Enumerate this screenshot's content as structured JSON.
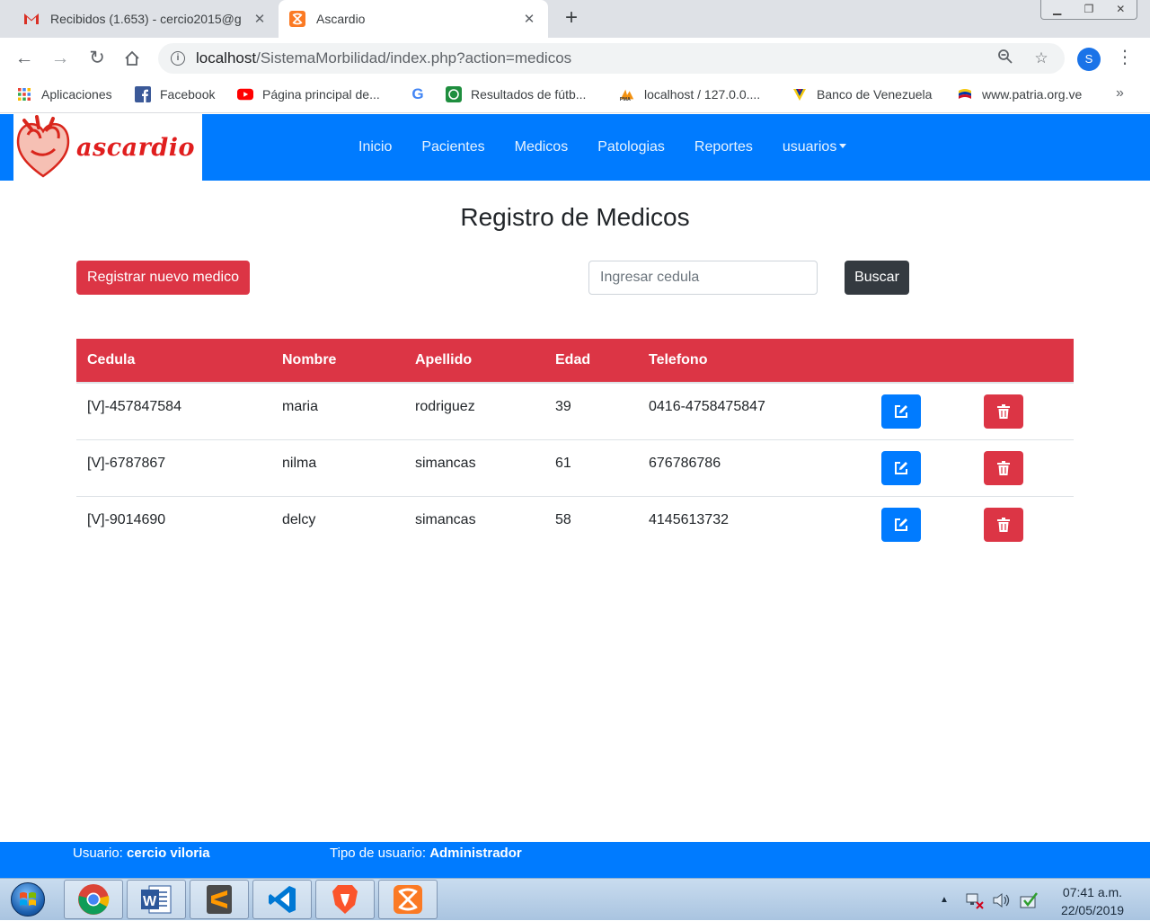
{
  "browser": {
    "tabs": [
      {
        "title": "Recibidos (1.653) - cercio2015@g",
        "icon": "gmail-icon"
      },
      {
        "title": "Ascardio",
        "icon": "xampp-icon"
      }
    ],
    "url_host": "localhost",
    "url_path": "/SistemaMorbilidad/index.php?action=medicos",
    "profile_initial": "S",
    "bookmarks": [
      {
        "label": "Aplicaciones"
      },
      {
        "label": "Facebook"
      },
      {
        "label": "Página principal de..."
      },
      {
        "label": ""
      },
      {
        "label": "Resultados de fútb..."
      },
      {
        "label": "localhost / 127.0.0...."
      },
      {
        "label": "Banco de Venezuela"
      },
      {
        "label": "www.patria.org.ve"
      }
    ],
    "more_label": "»"
  },
  "app": {
    "brand": "ascardio",
    "nav": [
      "Inicio",
      "Pacientes",
      "Medicos",
      "Patologias",
      "Reportes",
      "usuarios"
    ],
    "page_title": "Registro de Medicos",
    "new_button": "Registrar nuevo medico",
    "search_placeholder": "Ingresar cedula",
    "search_button": "Buscar",
    "table": {
      "headers": [
        "Cedula",
        "Nombre",
        "Apellido",
        "Edad",
        "Telefono"
      ],
      "rows": [
        [
          "[V]-457847584",
          "maria",
          "rodriguez",
          "39",
          "0416-4758475847"
        ],
        [
          "[V]-6787867",
          "nilma",
          "simancas",
          "61",
          "676786786"
        ],
        [
          "[V]-9014690",
          "delcy",
          "simancas",
          "58",
          "4145613732"
        ]
      ]
    },
    "footer": {
      "user_label": "Usuario:",
      "user_value": "cercio viloria",
      "type_label": "Tipo de usuario:",
      "type_value": "Administrador"
    }
  },
  "taskbar": {
    "apps": [
      "chrome",
      "word",
      "sublime-text",
      "vscode",
      "brave",
      "xampp"
    ],
    "time": "07:41 a.m.",
    "date": "22/05/2019"
  },
  "colors": {
    "primary": "#007bff",
    "danger": "#dc3545",
    "dark": "#343a40"
  }
}
